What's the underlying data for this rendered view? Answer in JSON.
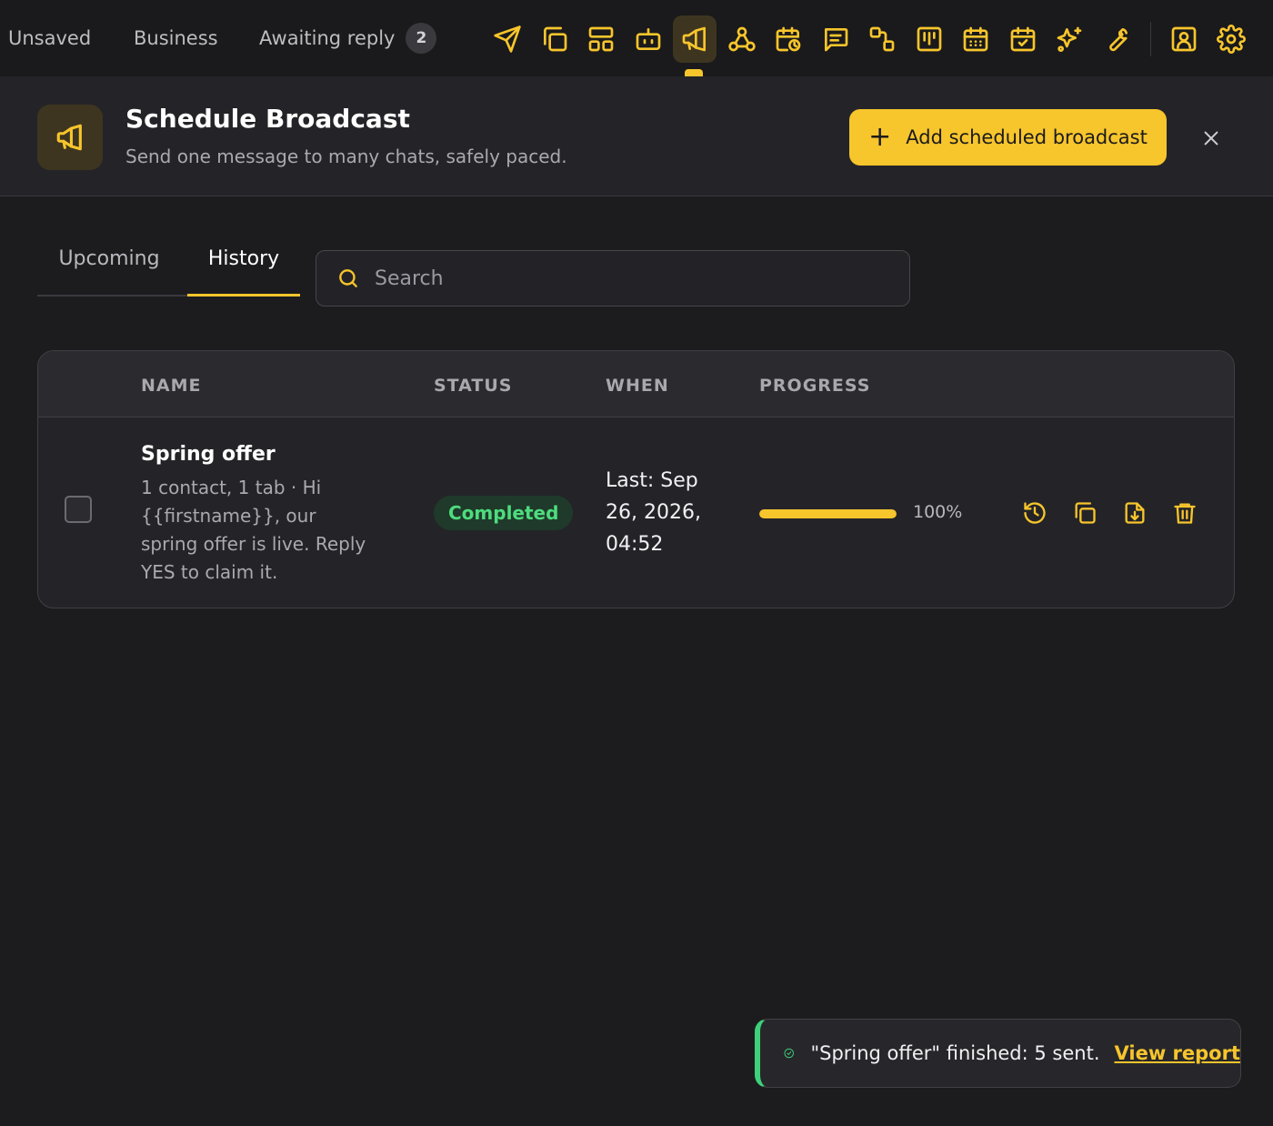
{
  "topbar": {
    "tabs": [
      {
        "label": "Unsaved"
      },
      {
        "label": "Business"
      },
      {
        "label": "Awaiting reply",
        "count": "2"
      }
    ],
    "tools": [
      {
        "icon": "send-icon"
      },
      {
        "icon": "copy-icon"
      },
      {
        "icon": "layout-icon"
      },
      {
        "icon": "robot-icon"
      },
      {
        "icon": "megaphone-icon",
        "active": true
      },
      {
        "icon": "webhook-icon"
      },
      {
        "icon": "calendar-clock-icon"
      },
      {
        "icon": "message-icon"
      },
      {
        "icon": "flow-icon"
      },
      {
        "icon": "kanban-icon"
      },
      {
        "icon": "calendar-grid-icon"
      },
      {
        "icon": "calendar-check-icon"
      },
      {
        "icon": "sparkles-icon"
      },
      {
        "icon": "wrench-icon"
      },
      {
        "icon": "contact-icon"
      },
      {
        "icon": "settings-icon"
      }
    ]
  },
  "header": {
    "icon": "megaphone-icon",
    "title": "Schedule Broadcast",
    "subtitle": "Send one message to many chats, safely paced.",
    "add_button": "Add scheduled broadcast"
  },
  "tabs": {
    "upcoming": "Upcoming",
    "history": "History",
    "active": "History"
  },
  "search": {
    "placeholder": "Search",
    "value": ""
  },
  "table": {
    "columns": [
      "NAME",
      "STATUS",
      "WHEN",
      "PROGRESS"
    ],
    "rows": [
      {
        "name": "Spring offer",
        "description": "1 contact, 1 tab · Hi {{firstname}}, our spring offer is live. Reply YES to claim it.",
        "status": "Completed",
        "when": "Last: Sep 26, 2026, 04:52",
        "progress": "100%",
        "progress_value": 1.0,
        "actions": [
          "history-icon",
          "duplicate-icon",
          "export-icon",
          "trash-icon"
        ]
      }
    ]
  },
  "toast": {
    "message": "\"Spring offer\" finished: 5 sent.",
    "link": "View report"
  },
  "colors": {
    "accent": "#f7c52c",
    "success": "#3dd17a",
    "background": "#1c1c1f"
  }
}
